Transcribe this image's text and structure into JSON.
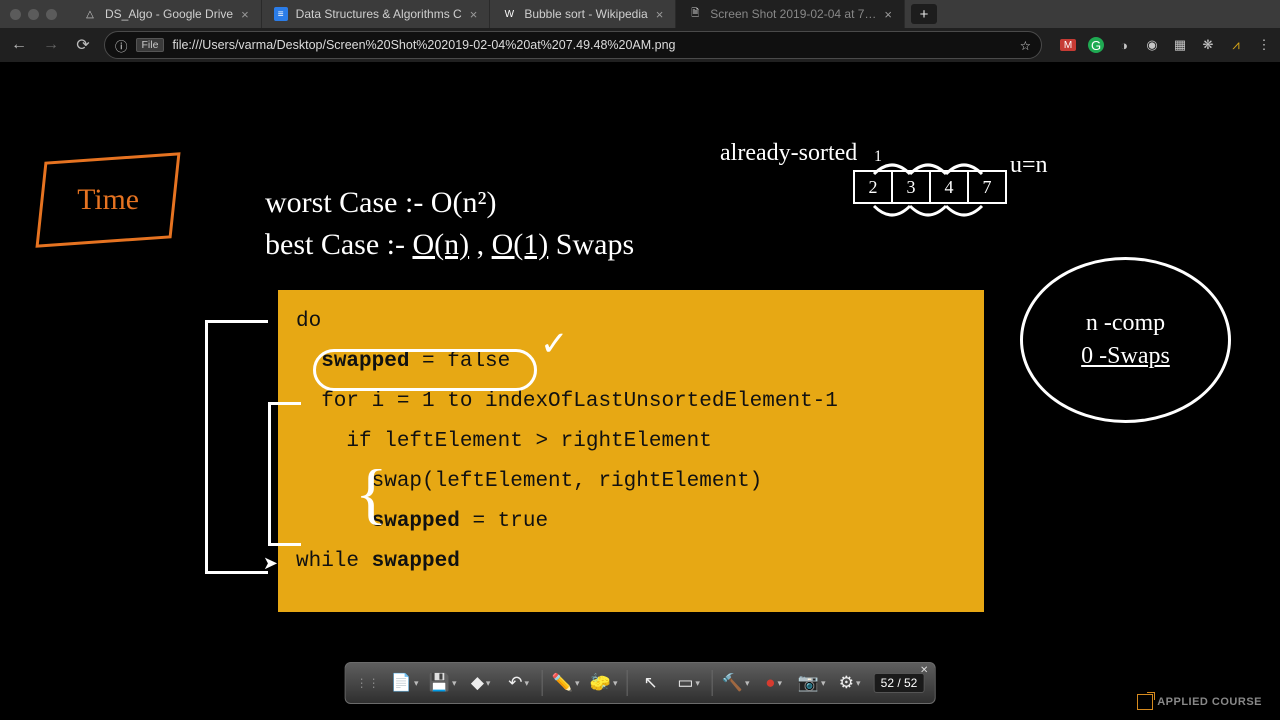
{
  "tabs": [
    {
      "label": "DS_Algo - Google Drive"
    },
    {
      "label": "Data Structures & Algorithms C"
    },
    {
      "label": "Bubble sort - Wikipedia"
    },
    {
      "label": "Screen Shot 2019-02-04 at 7…"
    }
  ],
  "address": {
    "chip": "File",
    "url": "file:///Users/varma/Desktop/Screen%20Shot%202019-02-04%20at%207.49.48%20AM.png"
  },
  "notes": {
    "time": "Time",
    "worst": "worst Case :- O(n²)",
    "best": "best Case :-  O(n)  , O(1) Swaps",
    "already": "already-sorted",
    "un": "u=n",
    "array": [
      "2",
      "3",
      "4",
      "7"
    ],
    "circle_l1": "n -comp",
    "circle_l2": "0 -Swaps"
  },
  "code": {
    "l1": "do",
    "l2": "  swapped = false",
    "l3": "  for i = 1 to indexOfLastUnsortedElement-1",
    "l4": "    if leftElement > rightElement",
    "l5": "      swap(leftElement, rightElement)",
    "l6": "      swapped = true",
    "l7": "while swapped"
  },
  "toolbar": {
    "page": "52 / 52"
  },
  "watermark": "APPLIED COURSE"
}
